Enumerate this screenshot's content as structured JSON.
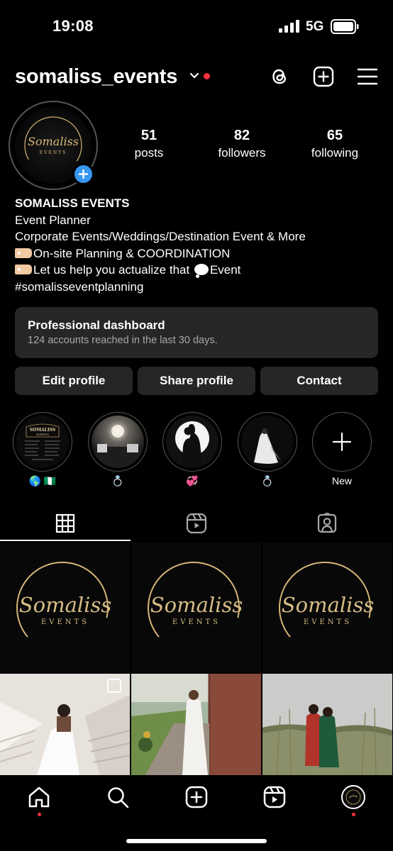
{
  "status_bar": {
    "time": "19:08",
    "network": "5G"
  },
  "header": {
    "username": "somaliss_events",
    "icons": [
      "threads-icon",
      "new-post-icon",
      "menu-icon"
    ]
  },
  "profile": {
    "avatar_logo_main": "Somaliss",
    "avatar_logo_sub": "EVENTS",
    "stats": [
      {
        "value": "51",
        "label": "posts"
      },
      {
        "value": "82",
        "label": "followers"
      },
      {
        "value": "65",
        "label": "following"
      }
    ],
    "name": "SOMALISS EVENTS",
    "category": "Event Planner",
    "bio_line1": "Corporate Events/Weddings/Destination Event & More",
    "bio_line2": "On-site Planning & COORDINATION",
    "bio_line3_a": "Let us help you actualize that",
    "bio_line3_b": "Event",
    "hashtag": "#somalisseventplanning"
  },
  "dashboard": {
    "title": "Professional dashboard",
    "subtitle": "124 accounts reached in the last 30 days."
  },
  "buttons": {
    "edit": "Edit profile",
    "share": "Share profile",
    "contact": "Contact"
  },
  "highlights": [
    {
      "caption": "🌎 🇳🇬",
      "thumb_title": "SOMALISS",
      "thumb_sub": "EVENTS"
    },
    {
      "caption": "💍"
    },
    {
      "caption": "💞"
    },
    {
      "caption": "💍"
    },
    {
      "caption": "New"
    }
  ],
  "grid_logo": {
    "main": "Somaliss",
    "sub": "EVENTS"
  },
  "colors": {
    "accent_blue": "#3797f0",
    "notification_red": "#ff3040",
    "card_bg": "#262626",
    "logo_gold": "#c9a86a"
  }
}
